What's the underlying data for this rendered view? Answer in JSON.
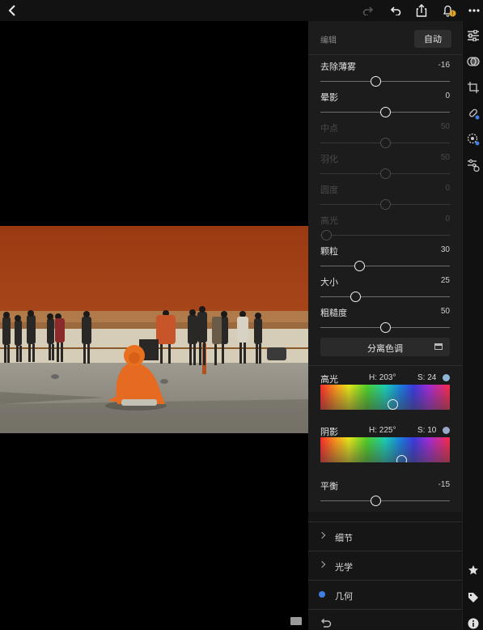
{
  "panel": {
    "title": "编辑",
    "auto_label": "自动",
    "sliders": [
      {
        "label": "去除薄雾",
        "value": "-16",
        "fraction": 0.43,
        "enabled": true
      },
      {
        "label": "晕影",
        "value": "0",
        "fraction": 0.5,
        "enabled": true
      },
      {
        "label": "中点",
        "value": "50",
        "fraction": 0.5,
        "enabled": false
      },
      {
        "label": "羽化",
        "value": "50",
        "fraction": 0.5,
        "enabled": false
      },
      {
        "label": "圆度",
        "value": "0",
        "fraction": 0.5,
        "enabled": false
      },
      {
        "label": "高光",
        "value": "0",
        "fraction": 0.0,
        "enabled": false
      },
      {
        "label": "颗粒",
        "value": "30",
        "fraction": 0.3,
        "enabled": true
      },
      {
        "label": "大小",
        "value": "25",
        "fraction": 0.27,
        "enabled": true
      },
      {
        "label": "粗糙度",
        "value": "50",
        "fraction": 0.5,
        "enabled": true
      }
    ],
    "split_toning_label": "分离色调",
    "highlights": {
      "label": "高光",
      "hue": "H:  203°",
      "saturation": "S:  24",
      "hue_fraction": 0.56,
      "sat_fraction": 0.24,
      "dot_color": "#8fb4d6"
    },
    "shadows": {
      "label": "阴影",
      "hue": "H:  225°",
      "saturation": "S:  10",
      "hue_fraction": 0.63,
      "sat_fraction": 0.1,
      "dot_color": "#9aa8c8"
    },
    "balance": {
      "label": "平衡",
      "value": "-15",
      "fraction": 0.43,
      "enabled": true
    },
    "sections": [
      {
        "label": "细节",
        "type": "chevron"
      },
      {
        "label": "光学",
        "type": "chevron"
      },
      {
        "label": "几何",
        "type": "dot"
      }
    ]
  },
  "toolbar": {
    "icons": [
      "back-icon",
      "redo-icon",
      "undo-icon",
      "share-icon",
      "notification-icon",
      "more-icon"
    ],
    "notification_badge": "!"
  },
  "toolstrip": {
    "icons": [
      "edit-sliders-icon",
      "presets-icon",
      "crop-icon",
      "healing-icon",
      "selective-icon",
      "versions-icon",
      "star-icon",
      "tag-icon",
      "info-icon"
    ]
  }
}
